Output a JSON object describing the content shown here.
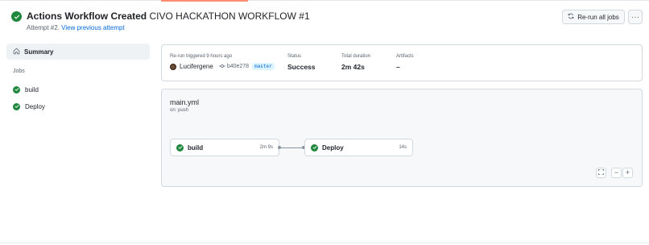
{
  "header": {
    "title_bold": "Actions Workflow Created",
    "title_rest": "CIVO HACKATHON WORKFLOW #1",
    "attempt_text": "Attempt #2.",
    "previous_attempt_link": "View previous attempt",
    "rerun_label": "Re-run all jobs",
    "more_icon": "kebab-horizontal-icon"
  },
  "sidebar": {
    "summary_label": "Summary",
    "jobs_heading": "Jobs",
    "jobs": [
      {
        "label": "build",
        "status": "success"
      },
      {
        "label": "Deploy",
        "status": "success"
      }
    ]
  },
  "run_info": {
    "trigger_label": "Re-run triggered 9 hours ago",
    "actor": "Lucifergene",
    "commit_sha": "b40e278",
    "branch": "master",
    "status_label": "Status",
    "status_value": "Success",
    "duration_label": "Total duration",
    "duration_value": "2m 42s",
    "artifacts_label": "Artifacts",
    "artifacts_value": "–"
  },
  "graph": {
    "file_name": "main.yml",
    "trigger": "on: push",
    "jobs": [
      {
        "name": "build",
        "duration": "2m 9s"
      },
      {
        "name": "Deploy",
        "duration": "14s"
      }
    ]
  },
  "colors": {
    "success": "#1f883d",
    "link": "#0969da",
    "border": "#d1d9e0",
    "muted": "#59636e"
  }
}
